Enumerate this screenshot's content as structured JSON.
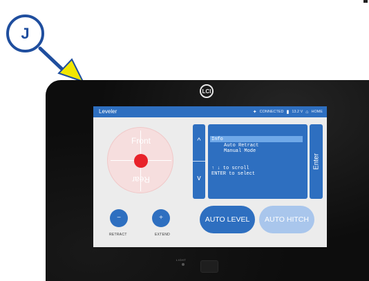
{
  "callout": {
    "letter": "J"
  },
  "device": {
    "logo_text": "LCI",
    "sensor_label": "LIGHT"
  },
  "header": {
    "title": "Leveler",
    "connected": "CONNECTED",
    "voltage": "13.2 V",
    "home": "HOME"
  },
  "compass": {
    "front": "Front",
    "rear": "Rear"
  },
  "nav": {
    "up": "^",
    "down": "v"
  },
  "menu": {
    "items": [
      "Info",
      "Auto Retract",
      "Manual Mode"
    ],
    "selected_index": 0,
    "hint_line1": "↑ ↓ to scroll",
    "hint_line2": "ENTER to select"
  },
  "enter_label": "Enter",
  "buttons": {
    "retract_symbol": "−",
    "extend_symbol": "+",
    "retract_label": "RETRACT",
    "extend_label": "EXTEND",
    "auto_level": "AUTO LEVEL",
    "auto_hitch": "AUTO HITCH"
  },
  "colors": {
    "accent": "#2e6fc0",
    "callout": "#1f4e9e",
    "arrow_head": "#f2e600",
    "bubble": "#e8222a",
    "disabled": "#a9c6ec"
  }
}
